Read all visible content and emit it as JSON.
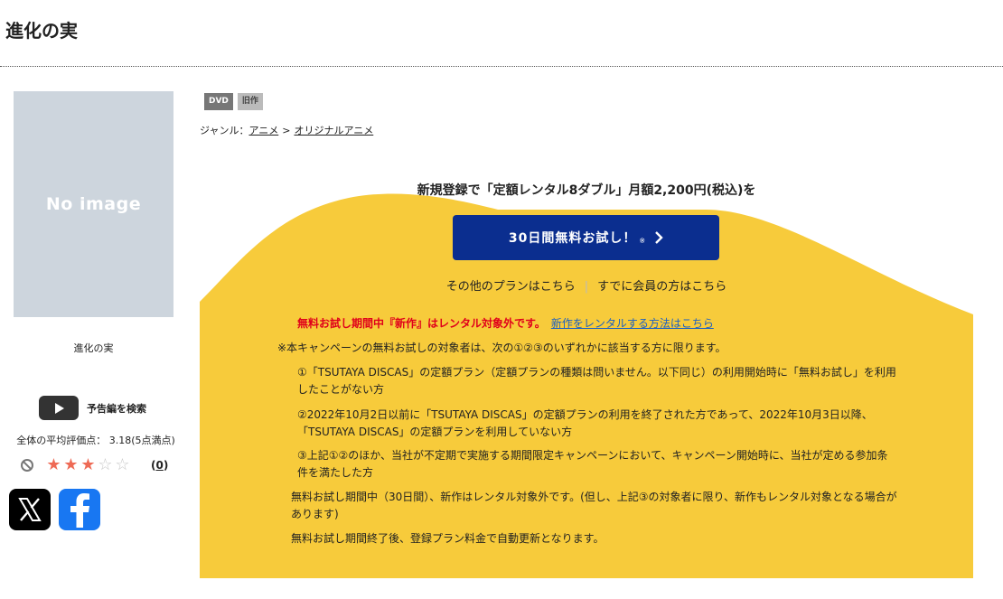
{
  "page": {
    "title": "進化の実"
  },
  "item": {
    "cover_text": "No image",
    "name": "進化の実",
    "trailer_label": "予告編を検索",
    "rating_text": "全体の平均評価点： 3.18(5点満点)",
    "rating_value": 3.18,
    "rating_max": 5,
    "stars_filled": 3,
    "review_count": "0",
    "review_open": "(",
    "review_close": ")"
  },
  "badges": {
    "dvd": "DVD",
    "old": "旧作"
  },
  "genre": {
    "prefix": "ジャンル：",
    "level1": "アニメ",
    "separator": ">",
    "level2": "オリジナルアニメ"
  },
  "promo": {
    "headline": "新規登録で「定額レンタル8ダブル」月額2,200円(税込)を",
    "button_label": "30日間無料お試し！",
    "button_mark": "※",
    "other_plans": "その他のプランはこちら",
    "divider": "|",
    "member_link": "すでに会員の方はこちら",
    "notice_red": "無料お試し期間中『新作』はレンタル対象外です。",
    "notice_link": "新作をレンタルする方法はこちら",
    "note_intro": "※本キャンペーンの無料お試しの対象者は、次の①②③のいずれかに該当する方に限ります。",
    "note_1": "①「TSUTAYA DISCAS」の定額プラン（定額プランの種類は問いません。以下同じ）の利用開始時に「無料お試し」を利用したことがない方",
    "note_2": "②2022年10月2日以前に「TSUTAYA DISCAS」の定額プランの利用を終了された方であって、2022年10月3日以降、「TSUTAYA DISCAS」の定額プランを利用していない方",
    "note_3": "③上記①②のほか、当社が不定期で実施する期間限定キャンペーンにおいて、キャンペーン開始時に、当社が定める参加条件を満たした方",
    "note_4": "無料お試し期間中（30日間）、新作はレンタル対象外です。(但し、上記③の対象者に限り、新作もレンタル対象となる場合があります)",
    "note_5": "無料お試し期間終了後、登録プラン料金で自動更新となります。"
  },
  "colors": {
    "panel_yellow": "#f7cb3b",
    "button_navy": "#0b2e8f",
    "notice_red": "#e0001b",
    "link_blue": "#1a5fc4",
    "star_on": "#ee6a55",
    "facebook_blue": "#1877f2"
  },
  "icons": {
    "trailer": "youtube-play-icon",
    "no_rating": "ban-icon",
    "x": "x-logo-icon",
    "facebook": "facebook-logo-icon",
    "button_chevron": "chevron-right-icon"
  }
}
